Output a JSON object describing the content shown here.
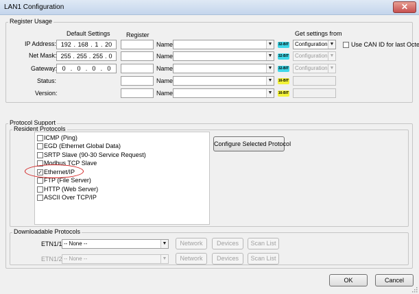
{
  "window": {
    "title": "LAN1 Configuration",
    "close_glyph": "✕"
  },
  "register_usage": {
    "group_label": "Register Usage",
    "col_default_settings": "Default Settings",
    "col_register": "Register",
    "col_get_settings_from": "Get settings from",
    "use_can_id_label": "Use CAN ID for last Octet",
    "name_label": "Name:",
    "rows": [
      {
        "label": "IP Address:",
        "octets": [
          "192",
          "168",
          "1",
          "20"
        ],
        "badge": "32-BIT",
        "source": "Configuration",
        "source_enabled": true
      },
      {
        "label": "Net Mask:",
        "octets": [
          "255",
          "255",
          "255",
          "0"
        ],
        "badge": "32-BIT",
        "source": "Configuration",
        "source_enabled": false
      },
      {
        "label": "Gateway:",
        "octets": [
          "0",
          "0",
          "0",
          "0"
        ],
        "badge": "32-BIT",
        "source": "Configuration",
        "source_enabled": false
      },
      {
        "label": "Status:",
        "octets": [],
        "badge": "16-BIT",
        "source": "",
        "source_enabled": false
      },
      {
        "label": "Version:",
        "octets": [],
        "badge": "16-BIT",
        "source": "",
        "source_enabled": false
      }
    ]
  },
  "protocol_support": {
    "group_label": "Protocol Support",
    "resident_label": "Resident Protocols",
    "configure_button": "Configure Selected Protocol",
    "protocols": [
      {
        "label": "ICMP (Ping)",
        "checked": false
      },
      {
        "label": "EGD (Ethernet Global Data)",
        "checked": false
      },
      {
        "label": "SRTP Slave (90-30 Service Request)",
        "checked": false
      },
      {
        "label": "Modbus TCP Slave",
        "checked": false
      },
      {
        "label": "Ethernet/IP",
        "checked": true
      },
      {
        "label": "FTP (File Server)",
        "checked": false
      },
      {
        "label": "HTTP (Web Server)",
        "checked": false
      },
      {
        "label": "ASCII Over TCP/IP",
        "checked": false
      }
    ],
    "check_glyph": "✓",
    "downloadable_label": "Downloadable Protocols",
    "downloadable": [
      {
        "label": "ETN1/1",
        "value": "-- None --",
        "enabled": true
      },
      {
        "label": "ETN1/2",
        "value": "-- None --",
        "enabled": false
      }
    ],
    "network_button": "Network",
    "devices_button": "Devices",
    "scanlist_button": "Scan List"
  },
  "footer": {
    "ok_button": "OK",
    "cancel_button": "Cancel"
  },
  "colors": {
    "badge_32": "#3fd7e8",
    "badge_16": "#f2f23a",
    "highlight_ellipse": "#d21e1e"
  },
  "icons": {
    "dropdown": "chevron-down-icon",
    "close": "close-icon"
  }
}
